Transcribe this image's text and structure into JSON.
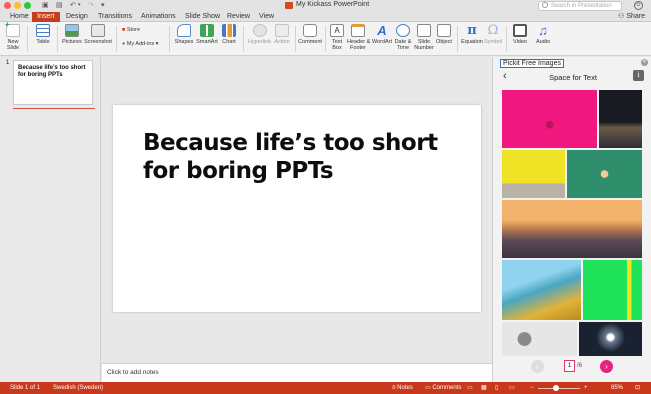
{
  "window": {
    "title": "My Kickass PowerPoint",
    "search_placeholder": "Search in Presentation",
    "share_label": "Share"
  },
  "tabs": [
    {
      "label": "Home",
      "active": false
    },
    {
      "label": "Insert",
      "active": true
    },
    {
      "label": "Design",
      "active": false
    },
    {
      "label": "Transitions",
      "active": false
    },
    {
      "label": "Animations",
      "active": false
    },
    {
      "label": "Slide Show",
      "active": false
    },
    {
      "label": "Review",
      "active": false
    },
    {
      "label": "View",
      "active": false
    }
  ],
  "ribbon": {
    "new_slide": "New\nSlide",
    "table": "Table",
    "pictures": "Pictures",
    "screenshot": "Screenshot",
    "store": "Store",
    "my_addins": "My Add-ins",
    "shapes": "Shapes",
    "smartart": "SmartArt",
    "chart": "Chart",
    "hyperlink": "Hyperlink",
    "action": "Action",
    "comment": "Comment",
    "text_box": "Text\nBox",
    "header_footer": "Header &\nFooter",
    "wordart": "WordArt",
    "date_time": "Date &\nTime",
    "slide_number": "Slide\nNumber",
    "object": "Object",
    "equation": "Equation",
    "symbol": "Symbol",
    "video": "Video",
    "audio": "Audio"
  },
  "thumbnails": [
    {
      "number": "1",
      "text": "Because life’s too short for boring PPTs"
    }
  ],
  "slide": {
    "title": "Because life’s too short for boring PPTs"
  },
  "notes": {
    "placeholder": "Click to add notes"
  },
  "pane": {
    "title": "Pickit Free Images",
    "subtitle": "Space for Text",
    "info_icon": "i",
    "images": [
      {
        "name": "pink-wall-bicycle",
        "color": "#f0177e"
      },
      {
        "name": "dark-road-night",
        "color": "#2b2e36"
      },
      {
        "name": "yellow-wall-person",
        "color": "#e6dc1c"
      },
      {
        "name": "green-field-aerial",
        "color": "#2f8f6c"
      },
      {
        "name": "mountain-sunset",
        "color": "#b97a4e"
      },
      {
        "name": "yellow-flowers-blue-sky",
        "color": "#4aa6c2"
      },
      {
        "name": "bright-green-wall",
        "color": "#1fe35a"
      },
      {
        "name": "foggy-tree",
        "color": "#cfcfcf"
      },
      {
        "name": "night-light",
        "color": "#1a2130"
      }
    ],
    "pager": {
      "current": "1",
      "total": "/6"
    }
  },
  "status": {
    "slide": "Slide 1 of 1",
    "language": "Swedish (Sweden)",
    "notes": "Notes",
    "comments": "Comments",
    "zoom": "85%"
  },
  "colors": {
    "accent": "#c43e1c",
    "pager_next": "#e4247e"
  }
}
